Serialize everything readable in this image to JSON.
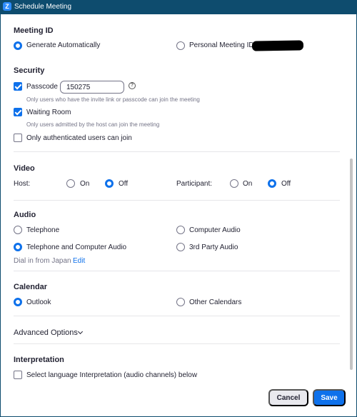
{
  "window": {
    "title": "Schedule Meeting",
    "app_icon": "Z"
  },
  "meeting_id": {
    "heading": "Meeting ID",
    "options": [
      {
        "label": "Generate Automatically",
        "selected": true
      },
      {
        "label": "Personal Meeting ID",
        "selected": false
      }
    ]
  },
  "security": {
    "heading": "Security",
    "passcode": {
      "label": "Passcode",
      "checked": true,
      "value": "150275",
      "help_icon": "?",
      "hint": "Only users who have the invite link or passcode can join the meeting"
    },
    "waiting_room": {
      "label": "Waiting Room",
      "checked": true,
      "hint": "Only users admitted by the host can join the meeting"
    },
    "authenticated_only": {
      "label": "Only authenticated users can join",
      "checked": false
    }
  },
  "video": {
    "heading": "Video",
    "host": {
      "label": "Host:",
      "on_label": "On",
      "off_label": "Off",
      "value": "Off"
    },
    "participant": {
      "label": "Participant:",
      "on_label": "On",
      "off_label": "Off",
      "value": "Off"
    }
  },
  "audio": {
    "heading": "Audio",
    "options": [
      {
        "label": "Telephone",
        "selected": false
      },
      {
        "label": "Computer Audio",
        "selected": false
      },
      {
        "label": "Telephone and Computer Audio",
        "selected": true
      },
      {
        "label": "3rd Party Audio",
        "selected": false
      }
    ],
    "dial_in": {
      "label": "Dial in from Japan",
      "edit_label": "Edit"
    }
  },
  "calendar": {
    "heading": "Calendar",
    "options": [
      {
        "label": "Outlook",
        "selected": true
      },
      {
        "label": "Other Calendars",
        "selected": false
      }
    ]
  },
  "advanced": {
    "label": "Advanced Options"
  },
  "interpretation": {
    "heading": "Interpretation",
    "option": {
      "label": "Select language Interpretation (audio channels) below",
      "checked": false
    }
  },
  "buttons": {
    "cancel": "Cancel",
    "save": "Save"
  },
  "colors": {
    "accent": "#0e71eb",
    "titlebar": "#0e4c6e",
    "text": "#232333",
    "hint": "#747487"
  }
}
